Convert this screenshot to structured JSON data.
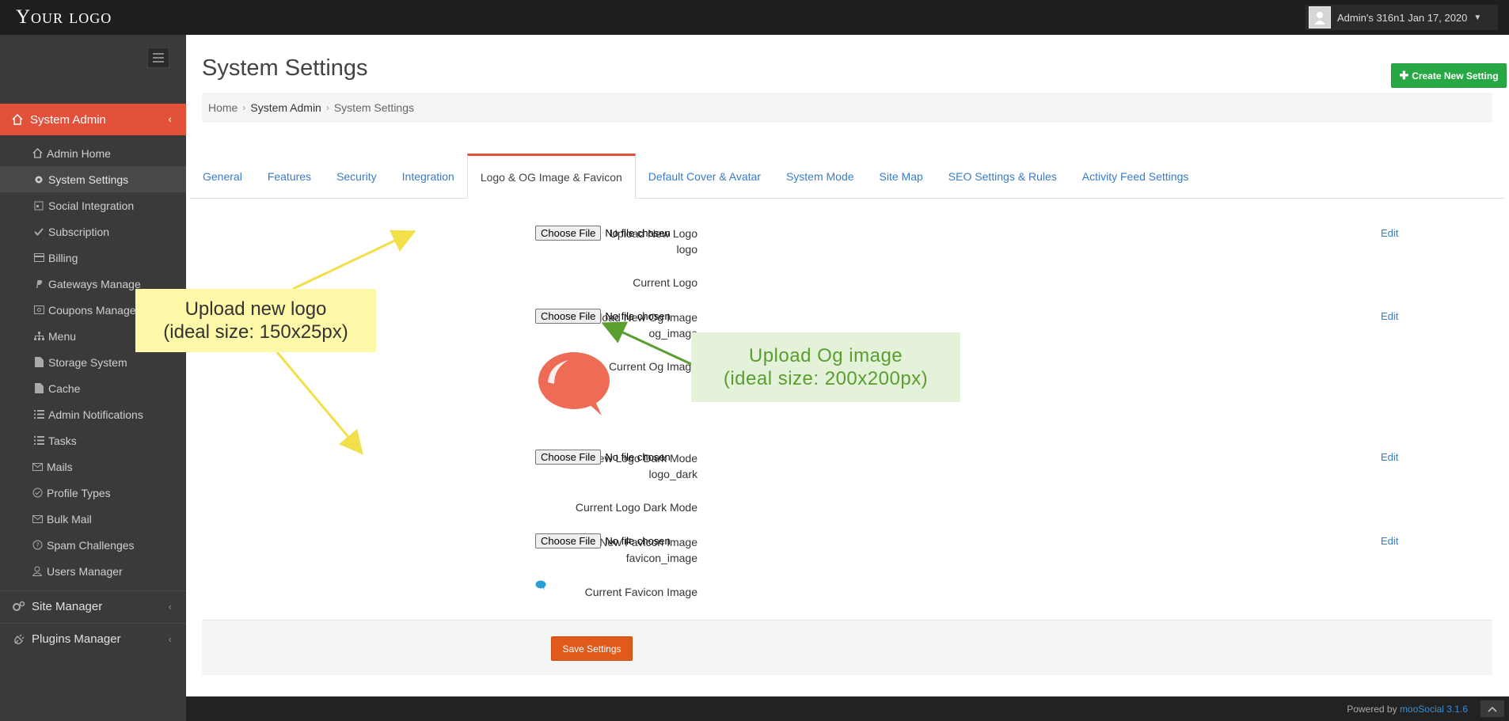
{
  "header": {
    "logo": "Your logo",
    "user": "Admin's 316n1 Jan 17, 2020"
  },
  "sidebar": {
    "section": "System Admin",
    "items": [
      {
        "label": "Admin Home",
        "icon": "home-icon"
      },
      {
        "label": "System Settings",
        "icon": "gear-icon",
        "active": true
      },
      {
        "label": "Social Integration",
        "icon": "share-icon"
      },
      {
        "label": "Subscription",
        "icon": "check-icon"
      },
      {
        "label": "Billing",
        "icon": "credit-card-icon"
      },
      {
        "label": "Gateways Manage",
        "icon": "paypal-icon"
      },
      {
        "label": "Coupons Manage",
        "icon": "coupon-icon"
      },
      {
        "label": "Menu",
        "icon": "sitemap-icon"
      },
      {
        "label": "Storage System",
        "icon": "file-icon"
      },
      {
        "label": "Cache",
        "icon": "file-icon"
      },
      {
        "label": "Admin Notifications",
        "icon": "list-icon"
      },
      {
        "label": "Tasks",
        "icon": "list-icon"
      },
      {
        "label": "Mails",
        "icon": "mail-icon"
      },
      {
        "label": "Profile Types",
        "icon": "check-circle-icon"
      },
      {
        "label": "Bulk Mail",
        "icon": "mail-icon"
      },
      {
        "label": "Spam Challenges",
        "icon": "question-icon"
      },
      {
        "label": "Users Manager",
        "icon": "user-icon"
      }
    ],
    "groups": [
      {
        "label": "Site Manager",
        "icon": "gears-icon"
      },
      {
        "label": "Plugins Manager",
        "icon": "plug-icon"
      }
    ]
  },
  "main": {
    "title": "System Settings",
    "create_button": "Create New Setting",
    "breadcrumb": [
      "Home",
      "System Admin",
      "System Settings"
    ],
    "tabs": [
      "General",
      "Features",
      "Security",
      "Integration",
      "Logo & OG Image & Favicon",
      "Default Cover & Avatar",
      "System Mode",
      "Site Map",
      "SEO Settings & Rules",
      "Activity Feed Settings"
    ],
    "active_tab": "Logo & OG Image & Favicon",
    "fields": {
      "logo_upload": {
        "label": "Upload New Logo",
        "key": "logo"
      },
      "logo_current": {
        "label": "Current Logo"
      },
      "og_upload": {
        "label": "Upload New Og Image",
        "key": "og_image"
      },
      "og_current": {
        "label": "Current Og Image"
      },
      "dark_upload": {
        "label": "Upload New Logo Dark Mode",
        "key": "logo_dark"
      },
      "dark_current": {
        "label": "Current Logo Dark Mode"
      },
      "favicon_upload": {
        "label": "Upload New Favicon Image",
        "key": "favicon_image"
      },
      "favicon_current": {
        "label": "Current Favicon Image"
      }
    },
    "file_button": "Choose File",
    "file_status": "No file chosen",
    "edit_label": "Edit",
    "save_button": "Save Settings"
  },
  "footer": {
    "powered_prefix": "Powered by",
    "powered_link": "mooSocial 3.1.6"
  },
  "annotations": {
    "logo_note_line1": "Upload new logo",
    "logo_note_line2": "(ideal size: 150x25px)",
    "og_note_line1": "Upload Og image",
    "og_note_line2": "(ideal size: 200x200px)"
  },
  "colors": {
    "accent": "#e3513a",
    "create": "#28a745",
    "save": "#e05b1a",
    "link": "#3a7cc4"
  }
}
